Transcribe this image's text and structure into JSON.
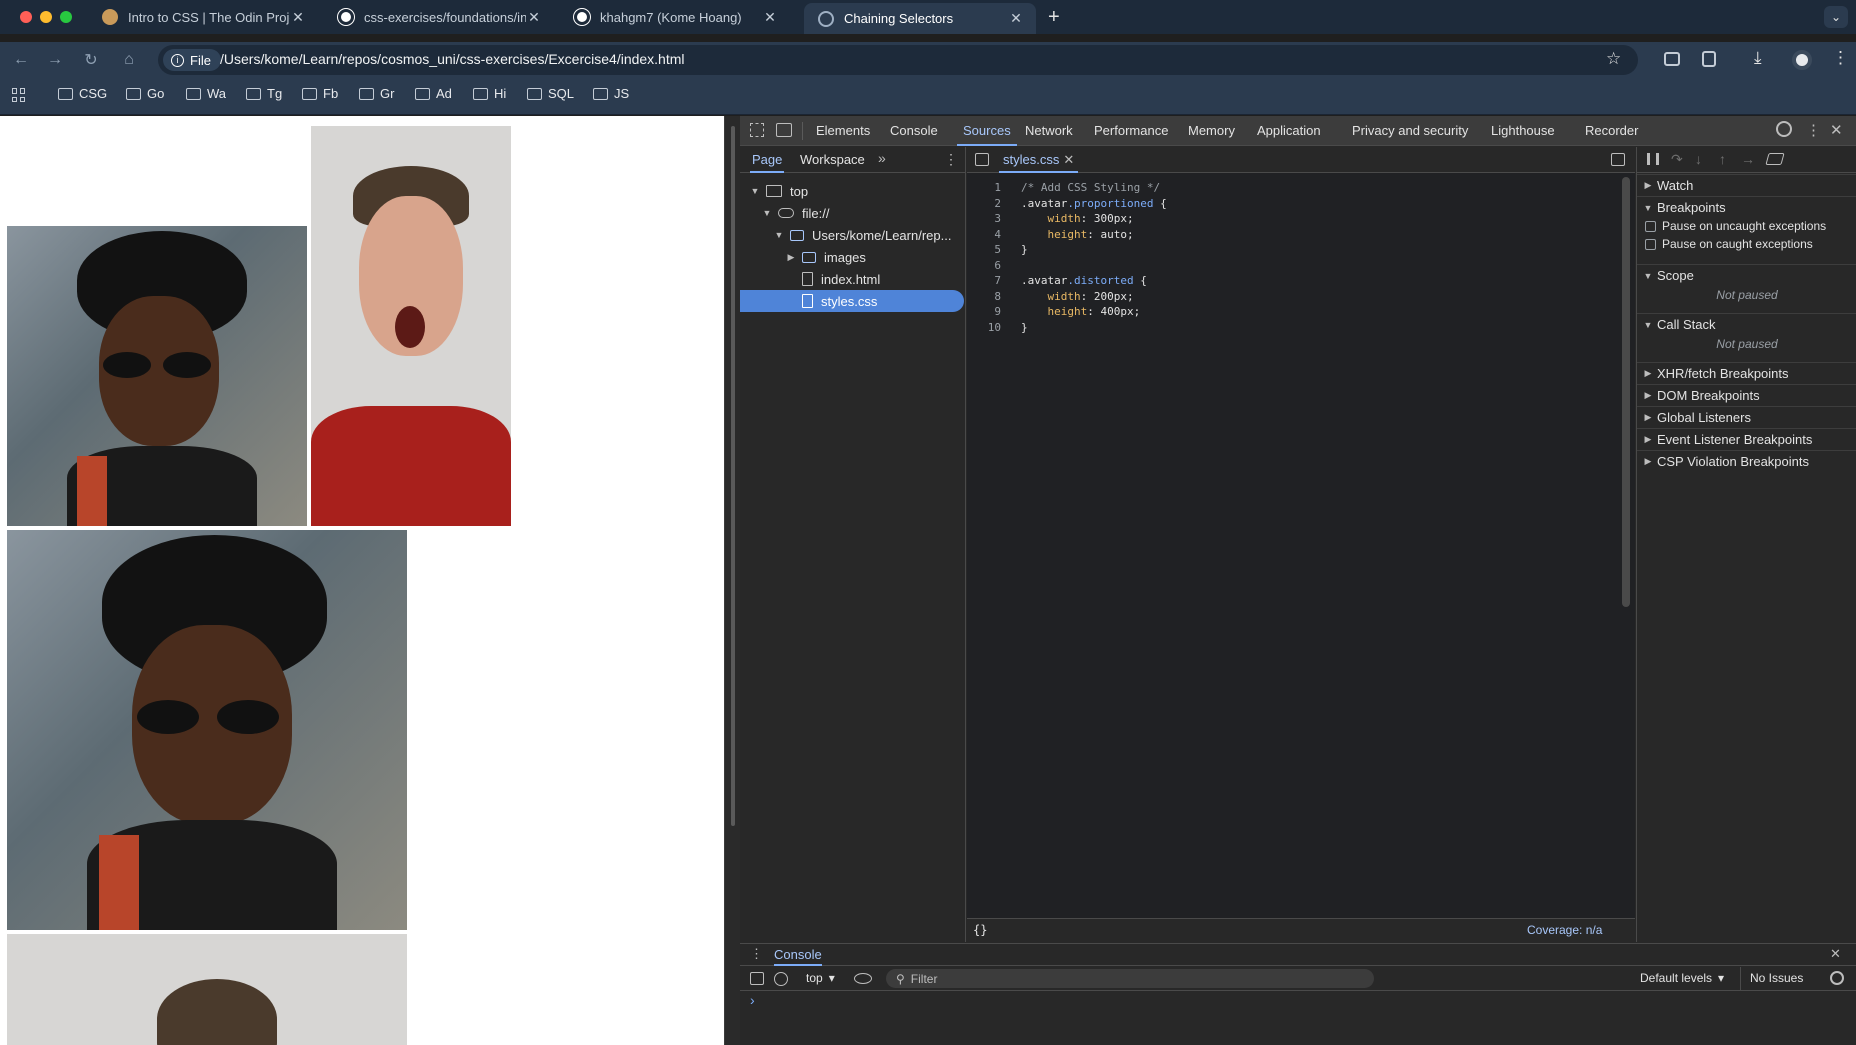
{
  "browser": {
    "tabs": [
      {
        "title": "Intro to CSS | The Odin Projec",
        "favicon": "odin-icon",
        "active": false
      },
      {
        "title": "css-exercises/foundations/int",
        "favicon": "github-icon",
        "active": false
      },
      {
        "title": "khahgm7 (Kome Hoang)",
        "favicon": "github-icon",
        "active": false
      },
      {
        "title": "Chaining Selectors",
        "favicon": "globe-icon",
        "active": true
      }
    ],
    "address": {
      "chip": "File",
      "url": "/Users/kome/Learn/repos/cosmos_uni/css-exercises/Excercise4/index.html"
    },
    "bookmarks": [
      "CSG",
      "Go",
      "Wa",
      "Tg",
      "Fb",
      "Gr",
      "Ad",
      "Hi",
      "SQL",
      "JS"
    ]
  },
  "devtools": {
    "tabs": [
      "Elements",
      "Console",
      "Sources",
      "Network",
      "Performance",
      "Memory",
      "Application",
      "Privacy and security",
      "Lighthouse",
      "Recorder"
    ],
    "active_tab": "Sources",
    "navigator": {
      "tabs": [
        "Page",
        "Workspace"
      ],
      "tree": [
        {
          "label": "top",
          "depth": 0,
          "icon": "frame-icon",
          "arrow": "down"
        },
        {
          "label": "file://",
          "depth": 1,
          "icon": "cloud-icon",
          "arrow": "down"
        },
        {
          "label": "Users/kome/Learn/rep...",
          "depth": 2,
          "icon": "folder-icon",
          "arrow": "down"
        },
        {
          "label": "images",
          "depth": 3,
          "icon": "folder-icon",
          "arrow": "right"
        },
        {
          "label": "index.html",
          "depth": 3,
          "icon": "file-icon",
          "arrow": ""
        },
        {
          "label": "styles.css",
          "depth": 3,
          "icon": "file-icon",
          "arrow": "",
          "selected": true
        }
      ]
    },
    "editor": {
      "file_tab": "styles.css",
      "lines": [
        {
          "n": "1",
          "text": "/* Add CSS Styling */"
        },
        {
          "n": "2",
          "text": ".avatar.proportioned {"
        },
        {
          "n": "3",
          "text": "    width: 300px;"
        },
        {
          "n": "4",
          "text": "    height: auto;"
        },
        {
          "n": "5",
          "text": "}"
        },
        {
          "n": "6",
          "text": ""
        },
        {
          "n": "7",
          "text": ".avatar.distorted {"
        },
        {
          "n": "8",
          "text": "    width: 200px;"
        },
        {
          "n": "9",
          "text": "    height: 400px;"
        },
        {
          "n": "10",
          "text": "}"
        }
      ],
      "format_label": "{}",
      "coverage": "Coverage: n/a"
    },
    "debugger": {
      "sections": [
        "Watch",
        "Breakpoints",
        "Scope",
        "Call Stack",
        "XHR/fetch Breakpoints",
        "DOM Breakpoints",
        "Global Listeners",
        "Event Listener Breakpoints",
        "CSP Violation Breakpoints"
      ],
      "checkboxes": [
        "Pause on uncaught exceptions",
        "Pause on caught exceptions"
      ],
      "not_paused": "Not paused"
    },
    "console": {
      "title": "Console",
      "context": "top",
      "filter_placeholder": "Filter",
      "levels": "Default levels",
      "issues": "No Issues",
      "prompt": "›"
    }
  },
  "colors": {
    "accent": "#7cacf8",
    "selection": "#4f84d8",
    "tabstrip": "#1d2a3a",
    "toolbar": "#2b3b4f"
  }
}
